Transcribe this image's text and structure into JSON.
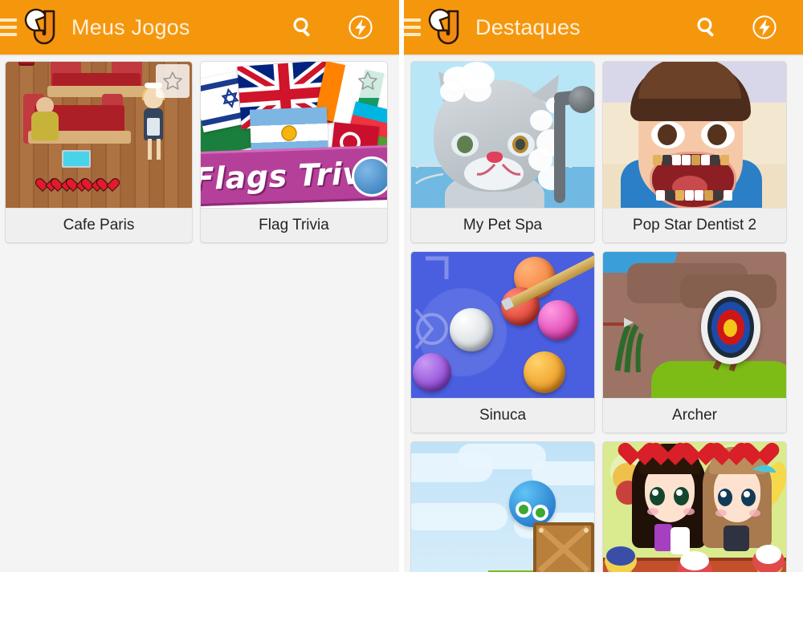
{
  "app": {
    "brand_logo_name": "jogos-j-logo",
    "accent_color": "#f5970d",
    "title_color": "#fdf0dc",
    "page_background": "#f4f4f4",
    "card_label_background": "#efefef"
  },
  "panels": [
    {
      "id": "meus-jogos",
      "header": {
        "menu_label": "Menu",
        "title": "Meus Jogos",
        "search_label": "Buscar",
        "boost_label": "Turbo"
      },
      "cards": [
        {
          "title": "Cafe Paris",
          "favorited": false,
          "star_label": "Favoritar"
        },
        {
          "title": "Flag Trivia",
          "favorited": false,
          "star_label": "Favoritar"
        }
      ]
    },
    {
      "id": "destaques",
      "header": {
        "menu_label": "Menu",
        "title": "Destaques",
        "search_label": "Buscar",
        "boost_label": "Turbo"
      },
      "cards": [
        {
          "title": "My Pet Spa"
        },
        {
          "title": "Pop Star Dentist 2"
        },
        {
          "title": "Sinuca"
        },
        {
          "title": "Archer"
        },
        {
          "title": ""
        },
        {
          "title": ""
        }
      ]
    }
  ]
}
